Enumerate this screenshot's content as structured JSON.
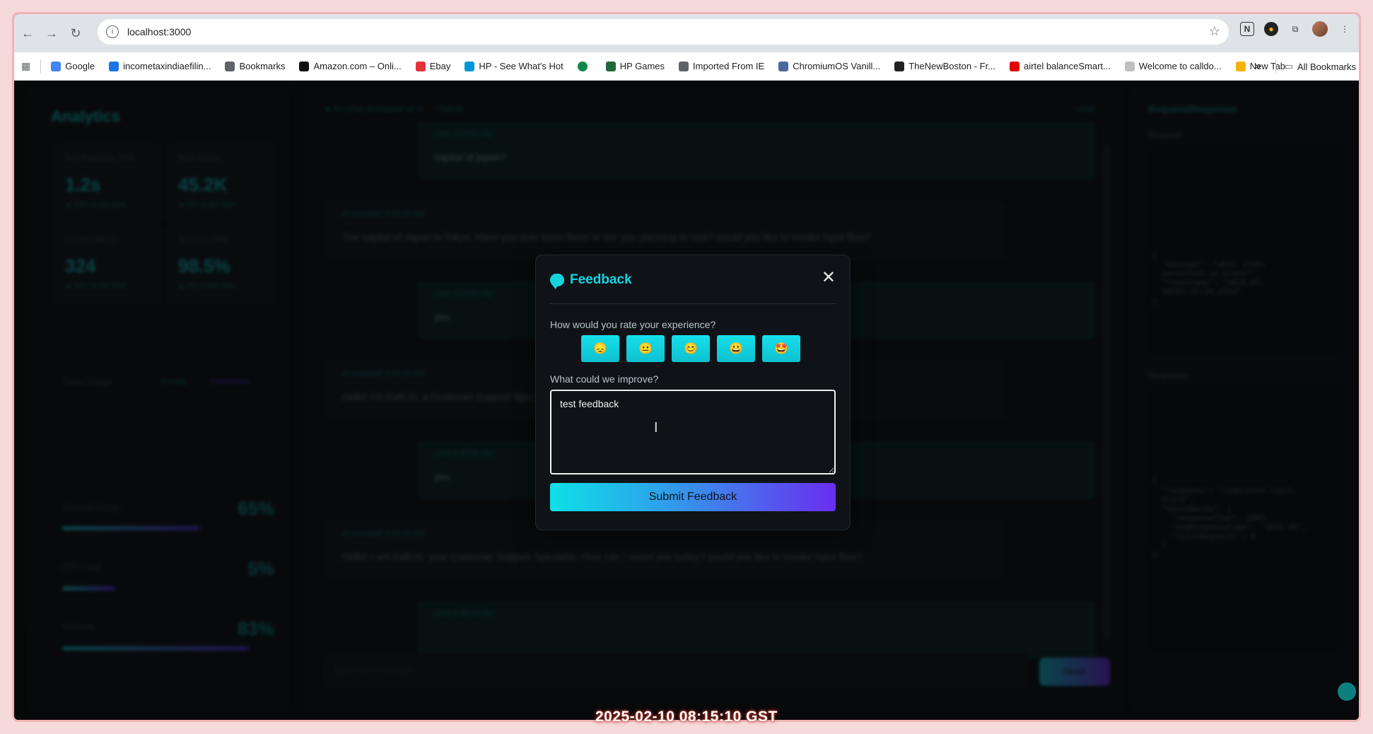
{
  "browser": {
    "url": "localhost:3000",
    "bookmarks": [
      {
        "label": "Google",
        "icon": "google-icon",
        "color": "#4285f4"
      },
      {
        "label": "incometaxindiaefilin...",
        "icon": "ie-icon",
        "color": "#1a73e8"
      },
      {
        "label": "Bookmarks",
        "icon": "star-icon",
        "color": "#5f6368"
      },
      {
        "label": "Amazon.com – Onli...",
        "icon": "amazon-icon",
        "color": "#111111"
      },
      {
        "label": "Ebay",
        "icon": "ebay-icon",
        "color": "#e53238"
      },
      {
        "label": "HP - See What's Hot",
        "icon": "hp-icon",
        "color": "#0096d6"
      },
      {
        "label": "",
        "icon": "circle-icon",
        "color": "#0a8a4a"
      },
      {
        "label": "HP Games",
        "icon": "games-icon",
        "color": "#1e6a3a"
      },
      {
        "label": "Imported From IE",
        "icon": "folder-icon",
        "color": "#5f6368"
      },
      {
        "label": "ChromiumOS Vanill...",
        "icon": "chromium-icon",
        "color": "#4a6aa0"
      },
      {
        "label": "TheNewBoston - Fr...",
        "icon": "nb-icon",
        "color": "#222222"
      },
      {
        "label": "airtel balanceSmart...",
        "icon": "airtel-icon",
        "color": "#e40000"
      },
      {
        "label": "Welcome to calldo...",
        "icon": "calldo-icon",
        "color": "#c0c0c0"
      },
      {
        "label": "New Tab",
        "icon": "newtab-icon",
        "color": "#f6b400"
      }
    ],
    "all_bookmarks": "All Bookmarks",
    "overflow": "»"
  },
  "app": {
    "left": {
      "title": "Analytics",
      "cards": [
        {
          "label": "Avg Response Time",
          "value": "1.2s",
          "sub": "▲ 10% vs last hour"
        },
        {
          "label": "Total Tokens",
          "value": "45.2K",
          "sub": "▲ 8% vs last hour"
        },
        {
          "label": "Conversations",
          "value": "324",
          "sub": "▲ 15% vs last hour"
        },
        {
          "label": "Accuracy Rate",
          "value": "98.5%",
          "sub": "▲ 2% vs last hour"
        }
      ],
      "token_usage": "Token Usage",
      "legend": [
        "Prompt",
        "Completion"
      ],
      "meters": [
        {
          "label": "Memory Usage",
          "value": "65%",
          "fraction": 0.65
        },
        {
          "label": "CPU Load",
          "value": "5%",
          "fraction": 0.25
        },
        {
          "label": "Network",
          "value": "83%",
          "fraction": 0.88
        }
      ]
    },
    "chat": {
      "header": "AI Chat Assistant v2.0",
      "header_status": "Online",
      "user_badge": "User",
      "messages": [
        {
          "role": "user",
          "meta": "User  3:15:00 AM",
          "text": "capital of japan?"
        },
        {
          "role": "ai",
          "meta": "AI Assistant  3:15:00 AM",
          "text": "The capital of Japan is Tokyo. Have you ever been there or are you planning to visit? would you like to invoke input flow?"
        },
        {
          "role": "user",
          "meta": "User  3:15:05 AM",
          "text": "yes"
        },
        {
          "role": "ai",
          "meta": "AI Assistant  3:15:05 AM",
          "text": "Hello! I'm Calli AI, a Customer Support Specialist. How can I assist you today? would you like to invoke input flow?"
        },
        {
          "role": "user",
          "meta": "User  3:15:08 AM",
          "text": "yes"
        },
        {
          "role": "ai",
          "meta": "AI Assistant  3:15:08 AM",
          "text": "Hello! I am Calli AI, your Customer Support Specialist. How can I assist you today? would you like to invoke input flow?"
        },
        {
          "role": "user",
          "meta": "User  3:15:10 AM",
          "text": ""
        }
      ],
      "input_placeholder": "Type your message...",
      "send_label": "Send"
    },
    "right": {
      "title": "Request/Response",
      "request_label": "Request",
      "response_label": "Response",
      "request_code": "{\n  \"message\": \"what items\n  permitted in plane?\",\n  \"timestamp\": \"2025-02-\n  10T03:15:10.259Z\"\n}",
      "response_code": "{\n  \"response\": \"completed input\n  block\",\n  \"benchmarks\": {\n    \"responseTime\": 1065,\n    \"avgResponseTime\": \"1015.00\",\n    \"totalRequests\": 6\n  }\n}"
    }
  },
  "modal": {
    "title": "Feedback",
    "close": "✕",
    "rating_question": "How would you rate your experience?",
    "ratings": [
      "😞",
      "😐",
      "😊",
      "😀",
      "🤩"
    ],
    "improve_question": "What could we improve?",
    "feedback_text": "test feedback",
    "submit_label": "Submit Feedback"
  },
  "overlay_timestamp": "2025-02-10 08:15:10 GST"
}
